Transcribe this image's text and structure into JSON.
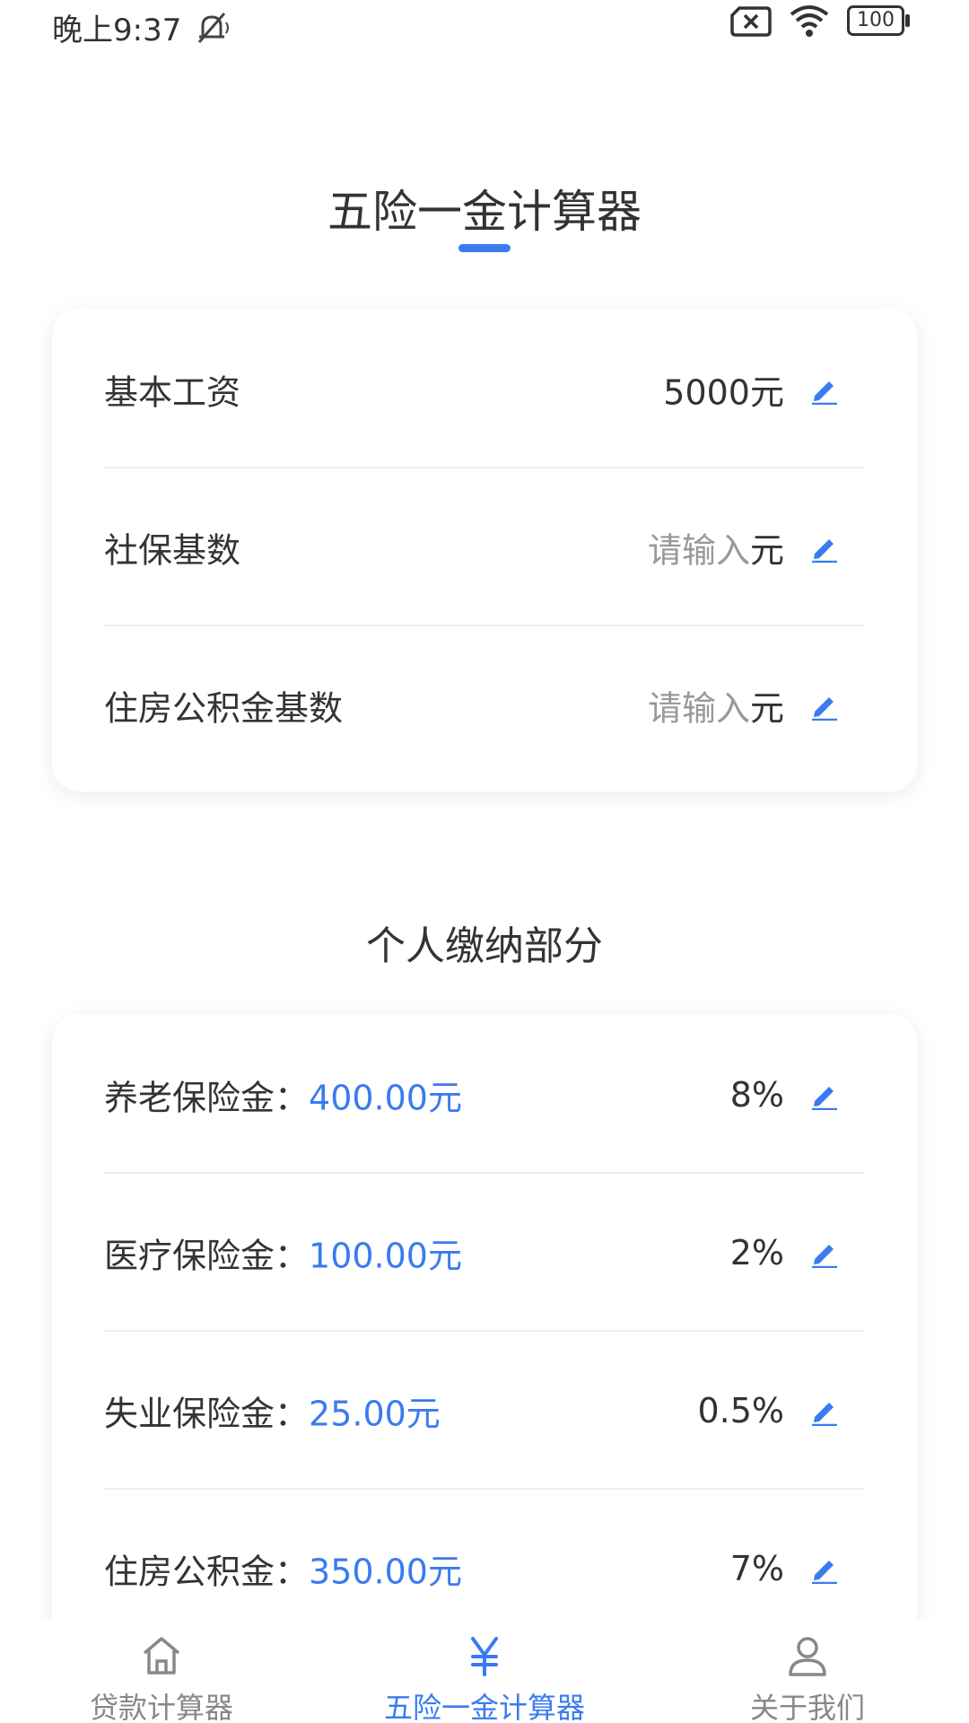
{
  "status_bar": {
    "time": "晚上9:37",
    "battery": "100"
  },
  "page_title": "五险一金计算器",
  "inputs": [
    {
      "label": "基本工资",
      "value": "5000",
      "placeholder": "",
      "unit": "元"
    },
    {
      "label": "社保基数",
      "value": "",
      "placeholder": "请输入",
      "unit": "元"
    },
    {
      "label": "住房公积金基数",
      "value": "",
      "placeholder": "请输入",
      "unit": "元"
    }
  ],
  "section_title": "个人缴纳部分",
  "contributions": [
    {
      "label": "养老保险金：",
      "amount": "400.00元",
      "rate": "8%"
    },
    {
      "label": "医疗保险金：",
      "amount": "100.00元",
      "rate": "2%"
    },
    {
      "label": "失业保险金：",
      "amount": "25.00元",
      "rate": "0.5%"
    },
    {
      "label": "住房公积金：",
      "amount": "350.00元",
      "rate": "7%"
    }
  ],
  "tabs": [
    {
      "label": "贷款计算器",
      "icon": "home-icon",
      "active": false
    },
    {
      "label": "五险一金计算器",
      "icon": "yen-icon",
      "active": true
    },
    {
      "label": "关于我们",
      "icon": "user-icon",
      "active": false
    }
  ],
  "colors": {
    "accent": "#3a7bf0",
    "text": "#333333",
    "placeholder": "#999999",
    "tab_inactive": "#888888"
  }
}
